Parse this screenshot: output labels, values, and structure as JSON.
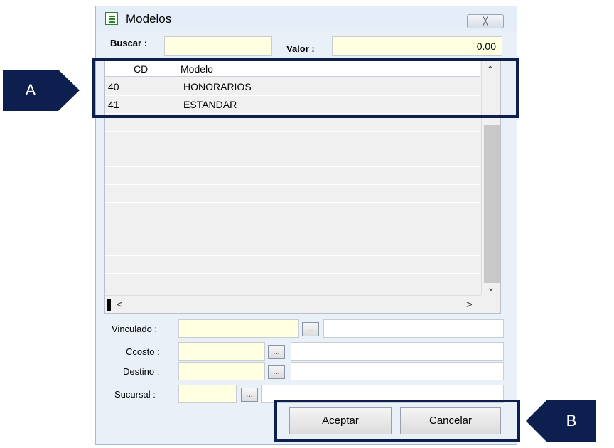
{
  "window": {
    "title": "Modelos",
    "close_glyph": "╳"
  },
  "search": {
    "buscar_label": "Buscar :",
    "buscar_value": "",
    "valor_label": "Valor :",
    "valor_value": "0.00"
  },
  "grid": {
    "columns": [
      "CD",
      "Modelo"
    ],
    "rows": [
      {
        "cd": "40",
        "modelo": "HONORARIOS"
      },
      {
        "cd": "41",
        "modelo": "ESTANDAR"
      }
    ]
  },
  "fields": {
    "vinculado_label": "Vinculado :",
    "ccosto_label": "Ccosto :",
    "destino_label": "Destino :",
    "sucursal_label": "Sucursal :",
    "ellipsis": "..."
  },
  "buttons": {
    "aceptar": "Aceptar",
    "cancelar": "Cancelar"
  },
  "annotations": {
    "a": "A",
    "b": "B"
  },
  "colors": {
    "input_bg": "#ffffe1",
    "annotation": "#0d1f4e",
    "window_bg": "#eaf0f8"
  }
}
